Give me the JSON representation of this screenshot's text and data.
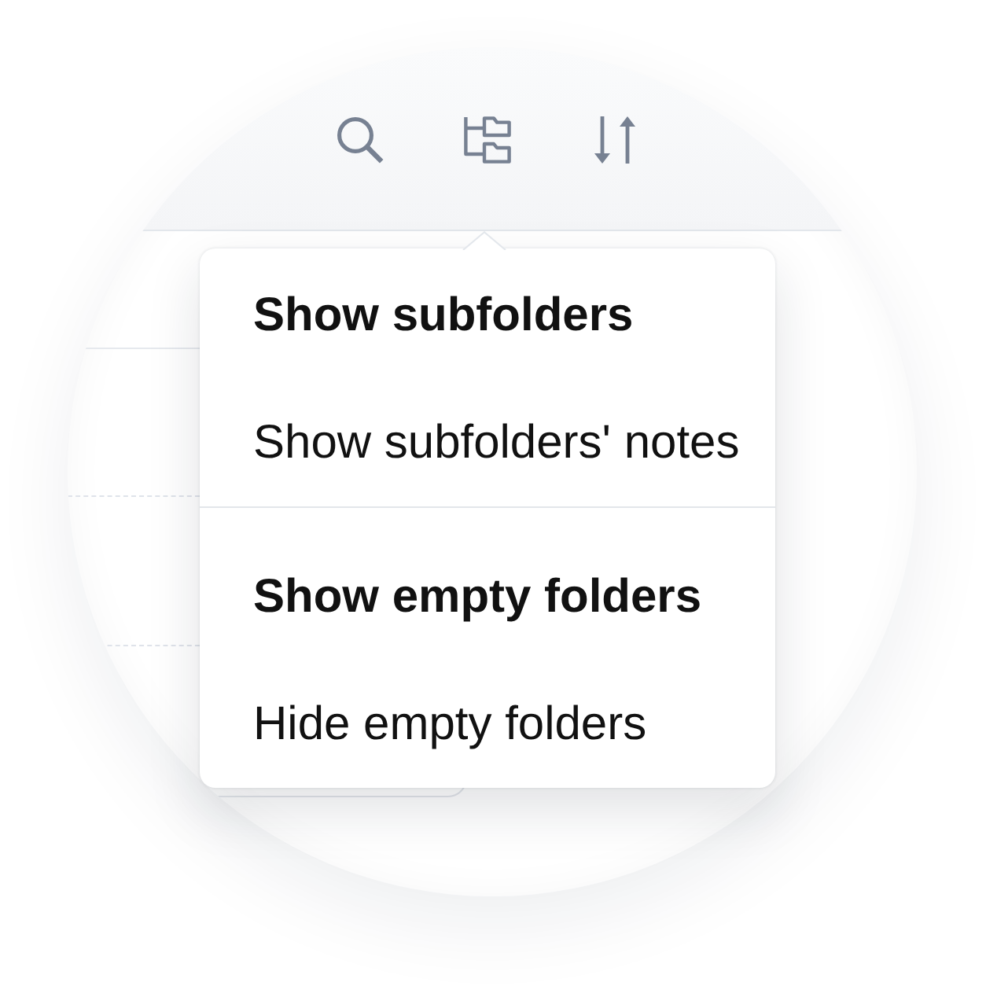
{
  "popover_menu": {
    "groups": [
      {
        "items": [
          {
            "label": "Show subfolders",
            "selected": true
          },
          {
            "label": "Show subfolders' notes",
            "selected": false
          }
        ]
      },
      {
        "items": [
          {
            "label": "Show empty folders",
            "selected": true
          },
          {
            "label": "Hide empty folders",
            "selected": false
          }
        ]
      }
    ]
  }
}
